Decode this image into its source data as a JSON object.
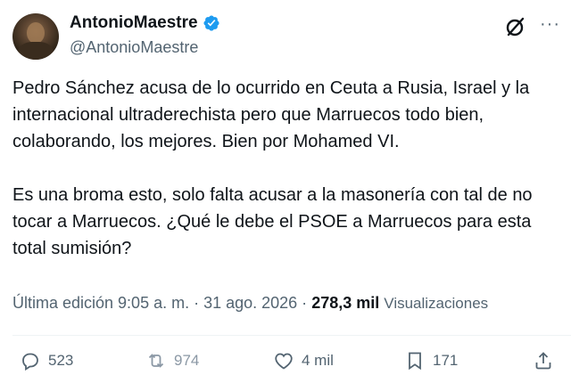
{
  "author": {
    "display_name": "AntonioMaestre",
    "handle": "@AntonioMaestre",
    "verified_color": "#1d9bf0"
  },
  "tweet": {
    "text": "Pedro Sánchez acusa de lo ocurrido en Ceuta a Rusia, Israel y la internacional ultraderechista pero que Marruecos todo bien, colaborando, los mejores. Bien por Mohamed VI.\n\nEs una broma esto, solo falta acusar a la masonería con tal de no tocar a Marruecos. ¿Qué le debe el PSOE a Marruecos para esta total sumisión?"
  },
  "meta": {
    "edited_label": "Última edición 9:05 a. m. · 31 ago. 2026 ·",
    "views_count": "278,3 mil",
    "views_label": "Visualizaciones"
  },
  "actions": {
    "replies": "523",
    "retweets": "974",
    "likes": "4 mil",
    "bookmarks": "171"
  },
  "icons": {
    "more": "more-icon",
    "grok": "grok-icon",
    "reply": "reply-icon",
    "retweet": "retweet-icon",
    "like": "heart-icon",
    "bookmark": "bookmark-icon",
    "share": "share-icon"
  }
}
